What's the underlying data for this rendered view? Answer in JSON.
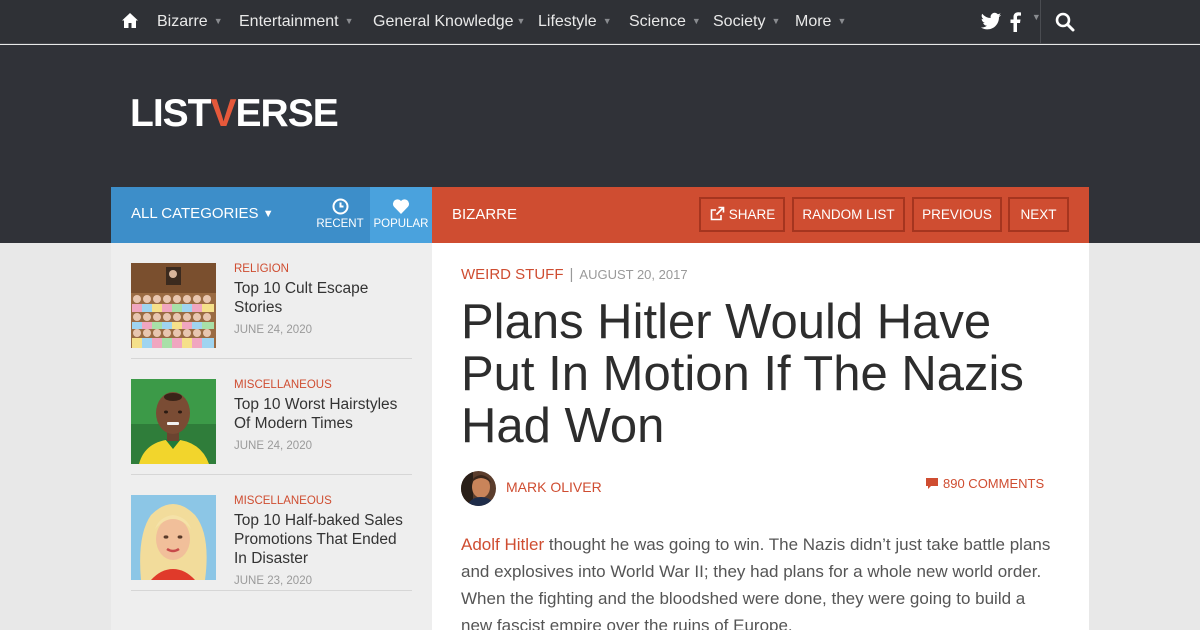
{
  "nav": {
    "items": [
      {
        "label": "Bizarre"
      },
      {
        "label": "Entertainment"
      },
      {
        "label": "General Knowledge"
      },
      {
        "label": "Lifestyle"
      },
      {
        "label": "Science"
      },
      {
        "label": "Society"
      },
      {
        "label": "More"
      }
    ],
    "icons": [
      "home-icon",
      "twitter-icon",
      "facebook-icon",
      "search-icon"
    ]
  },
  "logo": {
    "part1": "LIST",
    "part2": "V",
    "part3": "ERSE"
  },
  "catbar": {
    "all_categories": "ALL CATEGORIES",
    "recent": "RECENT",
    "popular": "POPULAR",
    "breadcrumb": "BIZARRE",
    "share": "SHARE",
    "random": "RANDOM LIST",
    "previous": "PREVIOUS",
    "next": "NEXT"
  },
  "sidebar": {
    "items": [
      {
        "category": "RELIGION",
        "title": "Top 10 Cult Escape Stories",
        "date": "JUNE 24, 2020"
      },
      {
        "category": "MISCELLANEOUS",
        "title": "Top 10 Worst Hairstyles Of Modern Times",
        "date": "JUNE 24, 2020"
      },
      {
        "category": "MISCELLANEOUS",
        "title": "Top 10 Half-baked Sales Promotions That Ended In Disaster",
        "date": "JUNE 23, 2020"
      }
    ]
  },
  "article": {
    "category": "WEIRD STUFF",
    "separator": "|",
    "date": "AUGUST 20, 2017",
    "title": "Plans Hitler Would Have Put In Motion If The Nazis Had Won",
    "author": "MARK OLIVER",
    "comments": "890 COMMENTS",
    "body_link": "Adolf Hitler",
    "body_rest": " thought he was going to win. The Nazis didn’t just take battle plans and explosives into World War II; they had plans for a whole new world order. When the fighting and the bloodshed were done, they were going to build a new fascist empire over the ruins of Europe."
  },
  "colors": {
    "accent": "#cf4d31",
    "blue": "#3d8ec9",
    "nav_bg": "#2f3136"
  }
}
